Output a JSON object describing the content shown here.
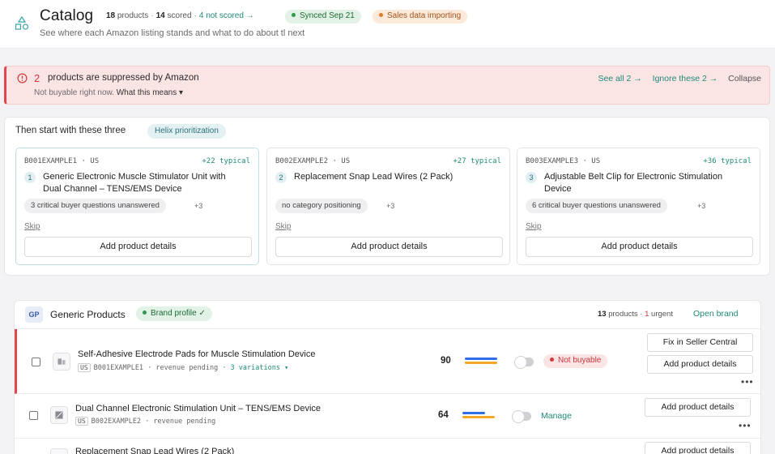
{
  "header": {
    "title": "Catalog",
    "stats": {
      "products_count": "18",
      "products_label": "products",
      "scored_count": "14",
      "scored_label": "scored",
      "not_scored_link": "4 not scored →"
    },
    "synced": "Synced Sep 21",
    "sales": "Sales data importing",
    "subtitle": "See where each Amazon listing stands and what to do about tl next"
  },
  "alert": {
    "count": "2",
    "title": "products are suppressed by Amazon",
    "sub": "Not buyable right now.",
    "what_means": "What this means ▾",
    "see_all": "See all 2 →",
    "ignore": "Ignore these 2 →",
    "collapse": "Collapse"
  },
  "suggestions": {
    "title": "Then start with these three",
    "tag": "Helix prioritization",
    "skip_label": "Skip",
    "button_label": "Add product details",
    "cards": [
      {
        "id": "B001EXAMPLE1 · US",
        "typical": "+22 typical",
        "num": "1",
        "name": "Generic Electronic Muscle Stimulator Unit with Dual Channel – TENS/EMS Device",
        "chip": "3 critical buyer questions unanswered",
        "more": "+3"
      },
      {
        "id": "B002EXAMPLE2 · US",
        "typical": "+27 typical",
        "num": "2",
        "name": "Replacement Snap Lead Wires (2 Pack)",
        "chip": "no category positioning",
        "more": "+3"
      },
      {
        "id": "B003EXAMPLE3 · US",
        "typical": "+36 typical",
        "num": "3",
        "name": "Adjustable Belt Clip for Electronic Stimulation Device",
        "chip": "6 critical buyer questions unanswered",
        "more": "+3"
      }
    ]
  },
  "brand": {
    "initials": "GP",
    "name": "Generic Products",
    "badge": "Brand profile ✓",
    "meta_products": "13",
    "meta_products_label": "products ·",
    "meta_urgent": "1",
    "meta_urgent_label": "urgent",
    "open": "Open brand"
  },
  "rows": [
    {
      "name": "Self-Adhesive Electrode Pads for Muscle Stimulation Device",
      "market": "US",
      "asin": "B001EXAMPLE1",
      "revenue": "· revenue pending",
      "variations": "· 3 variations ▾",
      "score": "90",
      "bar1": 0.92,
      "bar2": 0.92,
      "status": "Not buyable",
      "btn1": "Fix in Seller Central",
      "btn2": "Add product details",
      "more": "•••"
    },
    {
      "name": "Dual Channel Electronic Stimulation Unit – TENS/EMS Device",
      "market": "US",
      "asin": "B002EXAMPLE2",
      "revenue": "· revenue pending",
      "score": "64",
      "bar1": 0.64,
      "bar2": 0.92,
      "manage": "Manage",
      "btn2": "Add product details",
      "more": "•••"
    },
    {
      "name": "Replacement Snap Lead Wires (2 Pack)",
      "btn2": "Add product details"
    }
  ],
  "colors": {
    "accent": "#1f8a78",
    "danger": "#e0464b",
    "bar_blue": "#2f6ee8",
    "bar_orange": "#f5a623"
  }
}
